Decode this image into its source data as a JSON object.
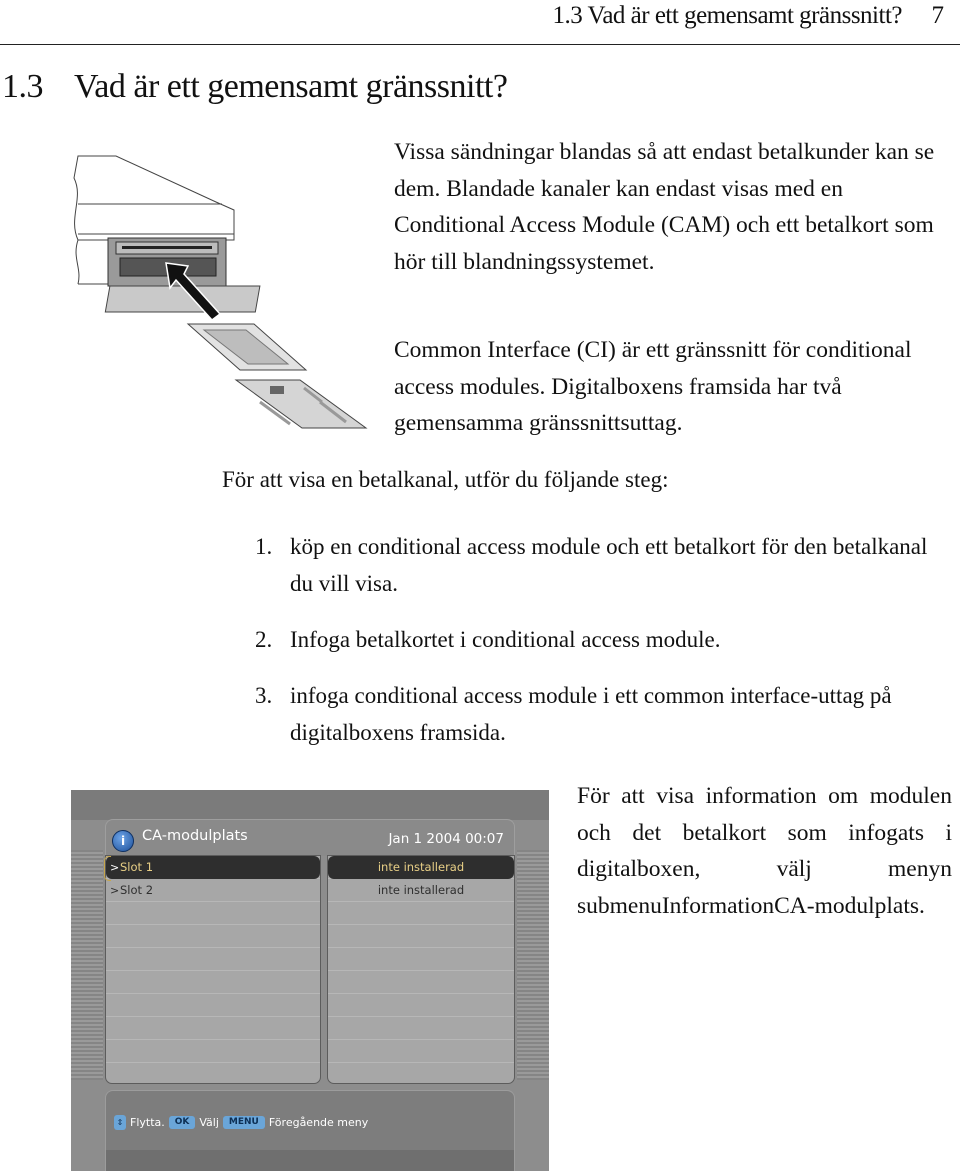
{
  "running_head": {
    "title": "1.3 Vad är ett gemensamt gränssnitt?",
    "page_number": "7"
  },
  "section": {
    "number": "1.3",
    "title": "Vad är ett gemensamt gränssnitt?"
  },
  "illustration": {
    "description": "CAM module and smart card being inserted into the digital box front slot",
    "icon": "cam-insertion-illustration"
  },
  "paragraphs": [
    "Vissa sändningar blandas så att endast betalkunder kan se dem. Blandade kanaler kan endast visas med en Conditional Access Module (CAM) och ett betalkort som hör till blandningssystemet.",
    "Common Interface (CI) är ett gränssnitt för conditional access modules. Digitalboxens framsida har två gemensamma gränssnittsuttag."
  ],
  "steps_intro": "För att visa en betalkanal, utför du följande steg:",
  "steps": [
    {
      "n": "1.",
      "text": "köp en conditional access module och ett betalkort för den betalkanal du vill visa."
    },
    {
      "n": "2.",
      "text": "Infoga betalkortet i conditional access module."
    },
    {
      "n": "3.",
      "text": "infoga conditional access module i ett common interface-uttag på digitalboxens framsida."
    }
  ],
  "side_text": "För att visa information om modulen och det betalkort som infogats i digitalboxen, välj menyn submenuInformationCA-modulplats.",
  "tv_screen": {
    "title": "CA-modulplats",
    "datetime": "Jan 1 2004 00:07",
    "info_icon": "i",
    "slots": [
      {
        "label": "Slot 1",
        "status": "inte installerad",
        "selected": true
      },
      {
        "label": "Slot 2",
        "status": "inte installerad",
        "selected": false
      }
    ],
    "chevron": ">",
    "footer": {
      "move_label": "Flytta.",
      "ok_key": "OK",
      "ok_label": "Välj",
      "menu_key": "MENU",
      "menu_label": "Föregående meny",
      "arrows_key": "⇕"
    },
    "colors": {
      "selected_text": "#e8cf86",
      "key_bg": "#6aa5d8",
      "info_icon": "#2a62b0"
    }
  }
}
